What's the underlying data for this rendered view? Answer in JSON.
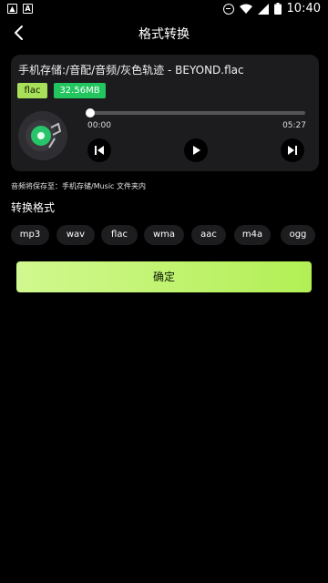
{
  "status": {
    "time": "10:40"
  },
  "header": {
    "title": "格式转换"
  },
  "file": {
    "name": "手机存储:/音配/音频/灰色轨迹 - BEYOND.flac",
    "format_tag": "flac",
    "size_tag": "32.56MB"
  },
  "player": {
    "current_time": "00:00",
    "total_time": "05:27",
    "progress": 0
  },
  "save_note": "音频将保存至：手机存储/Music 文件夹内",
  "convert_section": {
    "label": "转换格式"
  },
  "formats": [
    "mp3",
    "wav",
    "flac",
    "wma",
    "aac",
    "m4a",
    "ogg"
  ],
  "confirm_label": "确定",
  "colors": {
    "accent_green": "#22c55e",
    "lime": "#a9e05a",
    "button_gradient": "#c8f57a"
  }
}
